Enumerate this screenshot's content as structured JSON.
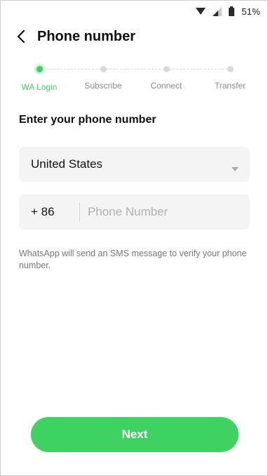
{
  "status_bar": {
    "battery_percent": "51%",
    "icons": [
      "wifi-icon",
      "cellular-signal-icon",
      "battery-icon"
    ]
  },
  "header": {
    "title": "Phone number",
    "back_icon": "back-arrow-icon"
  },
  "stepper": {
    "steps": [
      {
        "label": "WA Login",
        "active": true
      },
      {
        "label": "Subscribe",
        "active": false
      },
      {
        "label": "Connect",
        "active": false
      },
      {
        "label": "Transfer",
        "active": false
      }
    ],
    "active_color": "#3ecf62"
  },
  "form": {
    "heading": "Enter your phone number",
    "country": {
      "value": "United States",
      "icon": "dropdown-caret-icon"
    },
    "phone": {
      "country_code": "+ 86",
      "placeholder": "Phone Number",
      "value": ""
    },
    "helper_text": "WhatsApp will send an SMS message to verify your phone number."
  },
  "actions": {
    "next_label": "Next",
    "button_color": "#3fd263"
  }
}
